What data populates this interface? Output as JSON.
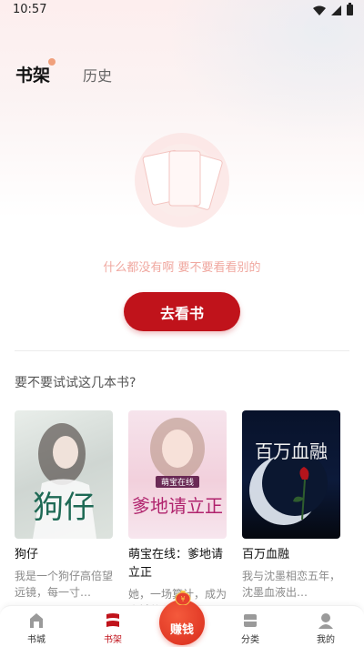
{
  "status_bar": {
    "time": "10:57"
  },
  "tabs": {
    "shelf": "书架",
    "history": "历史"
  },
  "empty": {
    "message": "什么都没有啊 要不要看看别的",
    "button": "去看书"
  },
  "suggest": {
    "title": "要不要试试这几本书?",
    "books": [
      {
        "title": "狗仔",
        "desc": "我是一个狗仔高倍望远镜，每一寸…",
        "cover_text": "狗仔"
      },
      {
        "title": "萌宝在线：爹地请立正",
        "desc": "她，一场算计，成为全城的…",
        "cover_text": "爹地请立正",
        "cover_badge": "萌宝在线"
      },
      {
        "title": "百万血融",
        "desc": "我与沈墨相恋五年，沈墨血液出…",
        "cover_text": "百万血融"
      }
    ]
  },
  "bottom_nav": {
    "items": [
      {
        "label": "书城",
        "icon": "home-icon"
      },
      {
        "label": "书架",
        "icon": "bookshelf-icon"
      },
      {
        "label": "赚钱",
        "icon": "money-bag-icon"
      },
      {
        "label": "分类",
        "icon": "category-icon"
      },
      {
        "label": "我的",
        "icon": "profile-icon"
      }
    ]
  },
  "colors": {
    "accent": "#c0131b",
    "empty_text": "#f0a8a0",
    "badge_dot": "#f0a07c"
  }
}
